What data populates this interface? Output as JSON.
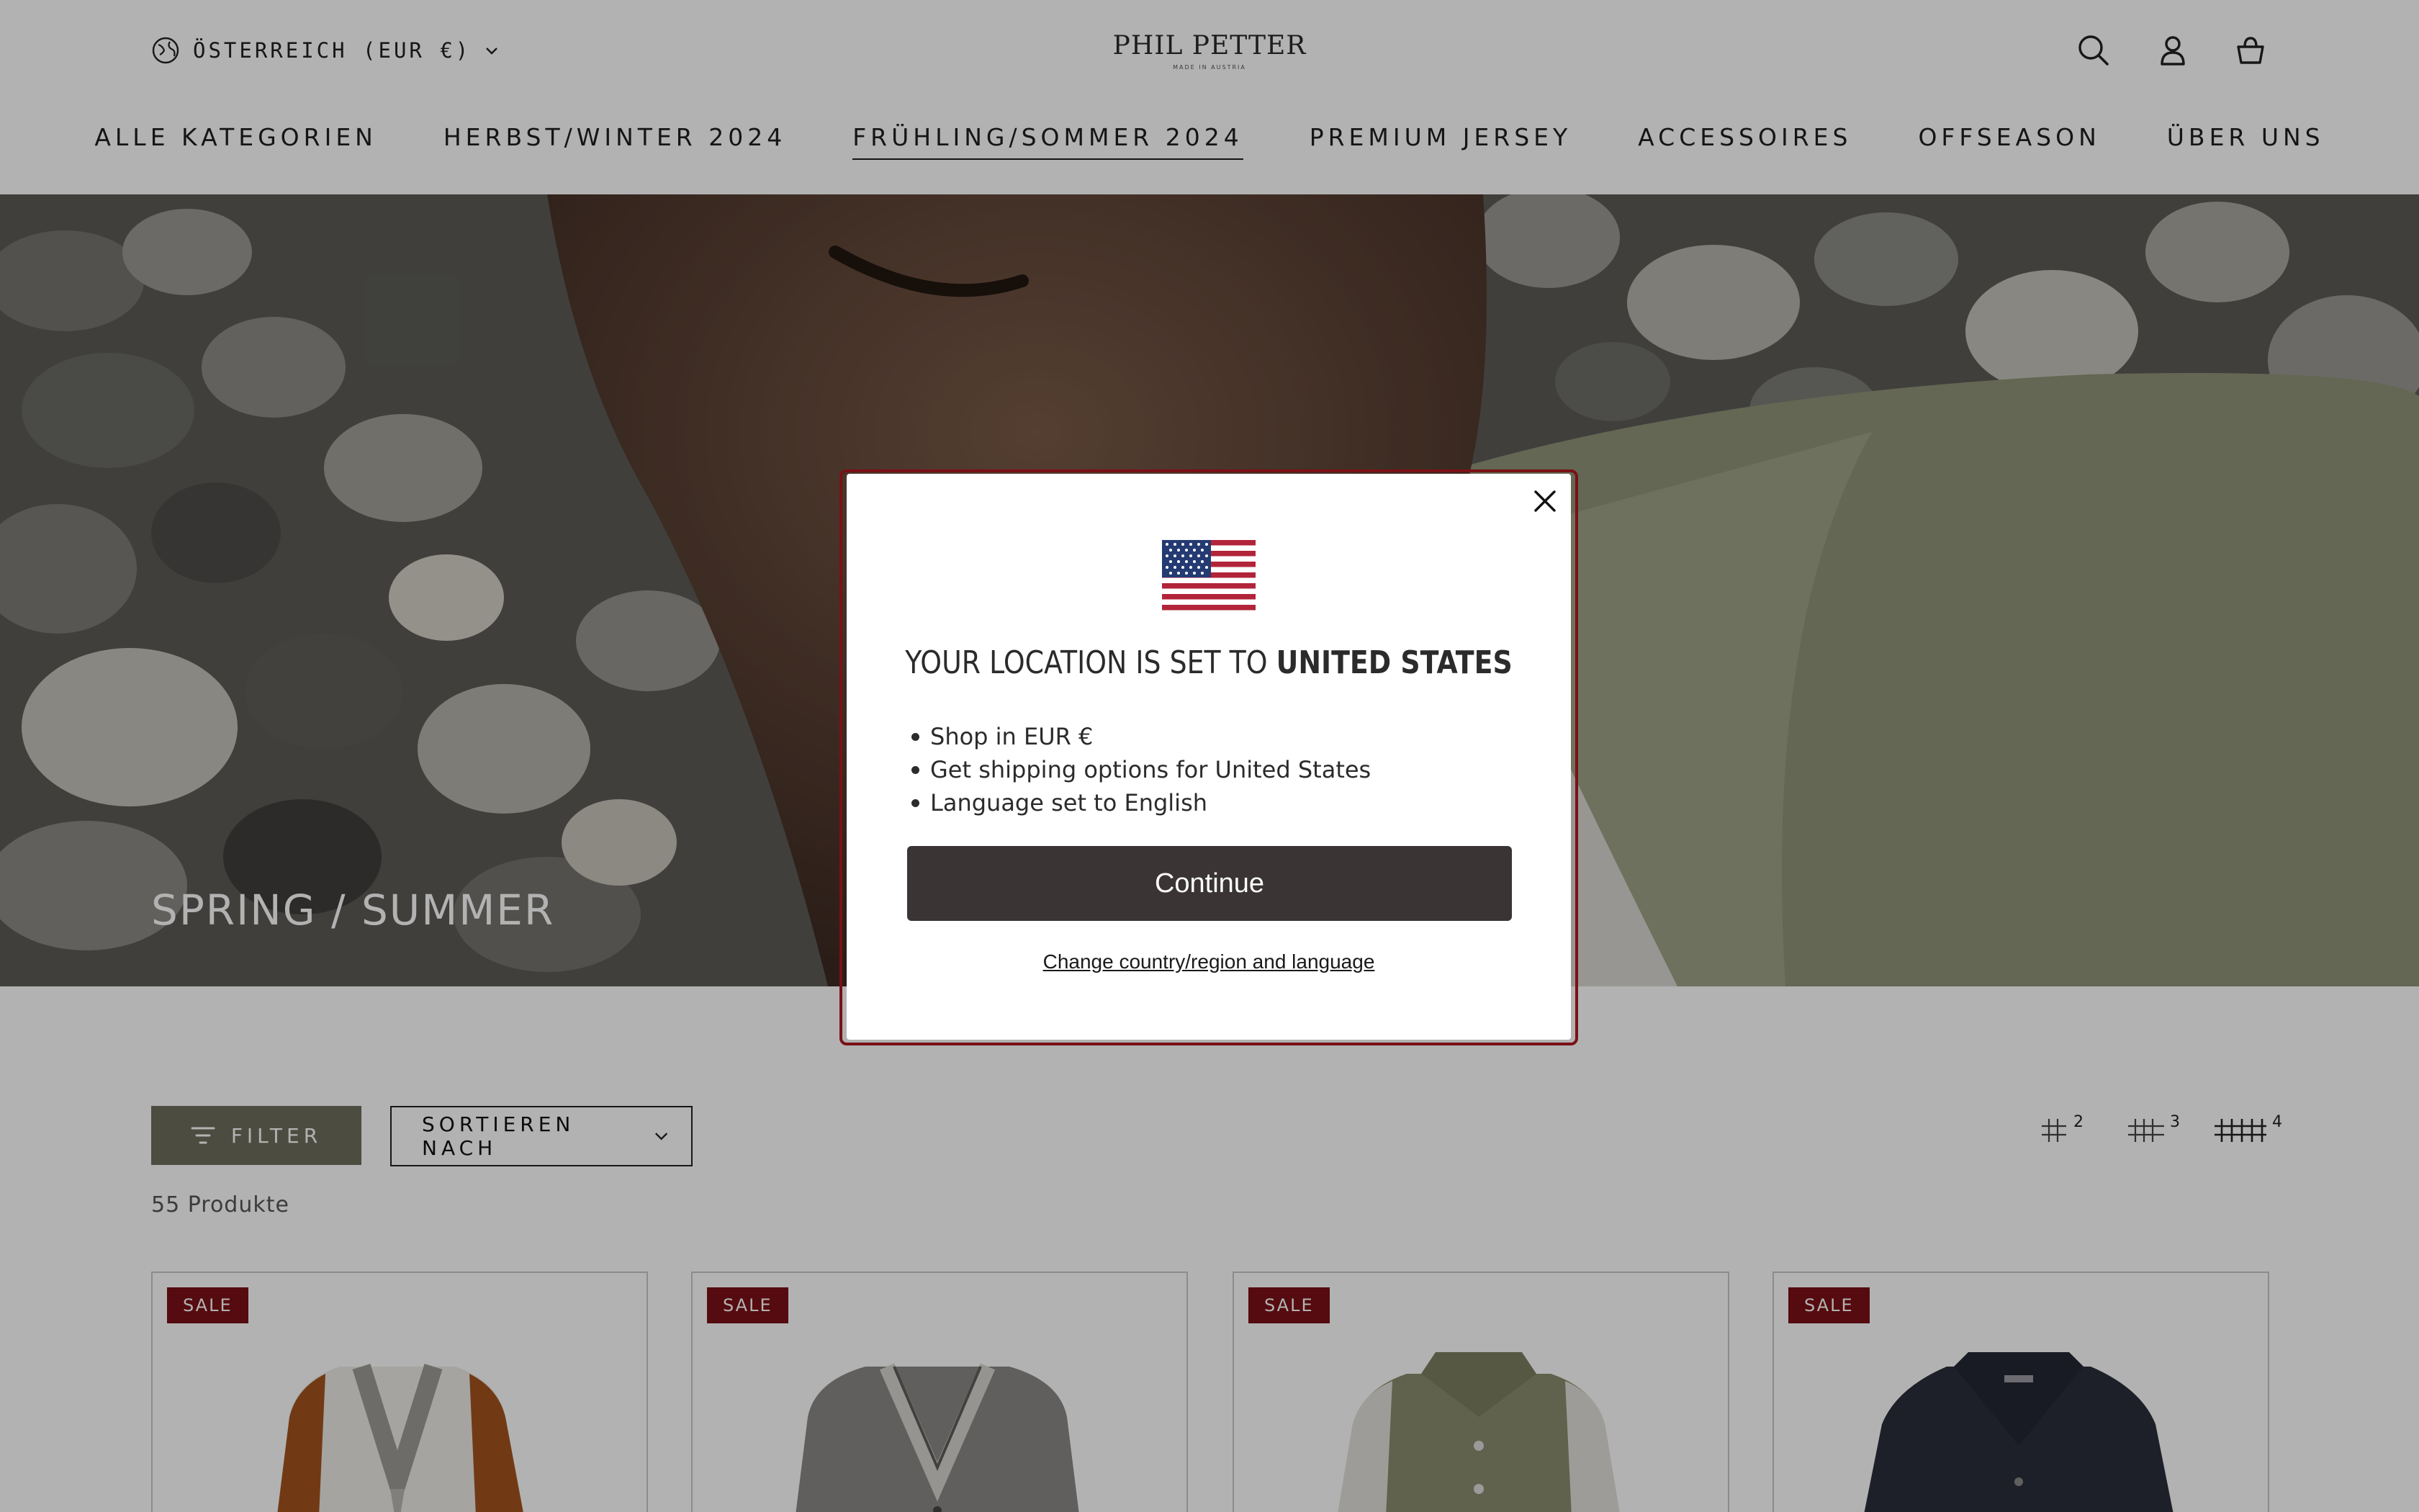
{
  "header": {
    "locale_label": "ÖSTERREICH (EUR €)",
    "logo_text": "PHIL PETTER",
    "logo_subtext": "MADE IN AUSTRIA",
    "nav": [
      {
        "label": "ALLE KATEGORIEN"
      },
      {
        "label": "HERBST/WINTER 2024"
      },
      {
        "label": "FRÜHLING/SOMMER 2024"
      },
      {
        "label": "PREMIUM JERSEY"
      },
      {
        "label": "ACCESSOIRES"
      },
      {
        "label": "OFFSEASON"
      },
      {
        "label": "ÜBER UNS"
      }
    ],
    "active_nav": "FRÜHLING/SOMMER 2024",
    "icons": [
      "search-icon",
      "account-icon",
      "cart-icon"
    ]
  },
  "hero": {
    "title": "SPRING / SUMMER"
  },
  "toolbar": {
    "filter_label": "FILTER",
    "sort_label": "SORTIEREN NACH",
    "grid_options": [
      "2",
      "3",
      "4"
    ],
    "product_count": "55 Produkte"
  },
  "products": [
    {
      "badge": "SALE"
    },
    {
      "badge": "SALE"
    },
    {
      "badge": "SALE"
    },
    {
      "badge": "SALE"
    }
  ],
  "modal": {
    "title_prefix": "YOUR LOCATION IS SET TO ",
    "title_country": "UNITED STATES",
    "bullets": [
      "Shop in EUR €",
      "Get shipping options for United States",
      "Language set to English"
    ],
    "continue_label": "Continue",
    "change_label": "Change country/region and language",
    "flag": "us-flag-icon"
  },
  "colors": {
    "sale_badge": "#7a1116",
    "filter_button": "#6d6e5c",
    "continue_button": "#3a3434",
    "modal_border": "#7a1116"
  }
}
